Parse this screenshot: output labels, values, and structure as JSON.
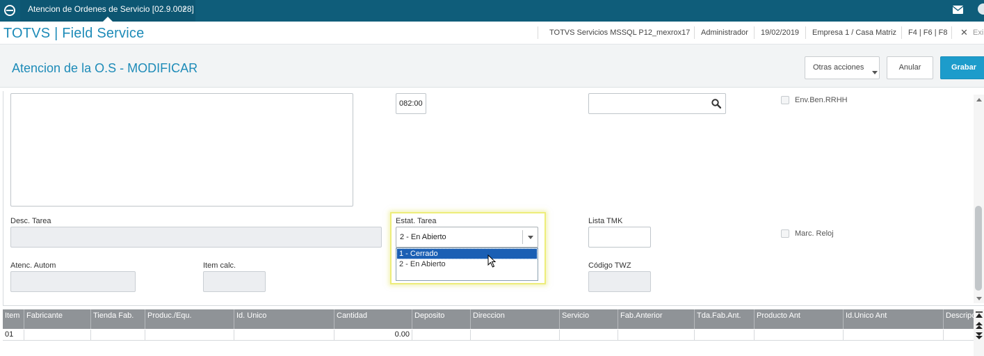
{
  "tab": {
    "title": "Atencion de Ordenes de Servicio [02.9.0028]",
    "close": "×"
  },
  "header": {
    "brand": "TOTVS | Field Service",
    "environment": "TOTVS Servicios MSSQL P12_mexrox17",
    "user": "Administrador",
    "date": "19/02/2019",
    "company": "Empresa 1 / Casa Matriz",
    "shortcuts": "F4 | F6 | F8",
    "close": "✕",
    "exit": "Exi"
  },
  "titlebar": {
    "title": "Atencion de la O.S - MODIFICAR",
    "other_actions": "Otras acciones",
    "cancel": "Anular",
    "save": "Grabar"
  },
  "form": {
    "time_value": "082:00",
    "env_ben_label": "Env.Ben.RRHH",
    "desc_label": "Desc. Tarea",
    "status_label": "Estat. Tarea",
    "status_value": "2 - En Abierto",
    "status_options": [
      "1 - Cerrado",
      "2 - En Abierto"
    ],
    "lista_tmk_label": "Lista TMK",
    "marc_reloj_label": "Marc. Reloj",
    "atenc_autom_label": "Atenc. Autom",
    "item_calc_label": "Item calc.",
    "codigo_twz_label": "Código TWZ"
  },
  "grid": {
    "columns": [
      "Item",
      "Fabricante",
      "Tienda Fab.",
      "Produc./Equ.",
      "Id. Unico",
      "Cantidad",
      "Deposito",
      "Direccion",
      "Servicio",
      "Fab.Anterior",
      "Tda.Fab.Ant.",
      "Producto Ant",
      "Id.Unico Ant",
      "Descripc"
    ],
    "rows": [
      [
        "01",
        "",
        "",
        "",
        "",
        "0.00",
        "",
        "",
        "",
        "",
        "",
        "",
        "",
        ""
      ]
    ]
  },
  "colors": {
    "topbar": "#0f5d7a",
    "brand": "#1d8bb8",
    "primary_button": "#1d9ccb",
    "selection": "#1a5fb4"
  }
}
